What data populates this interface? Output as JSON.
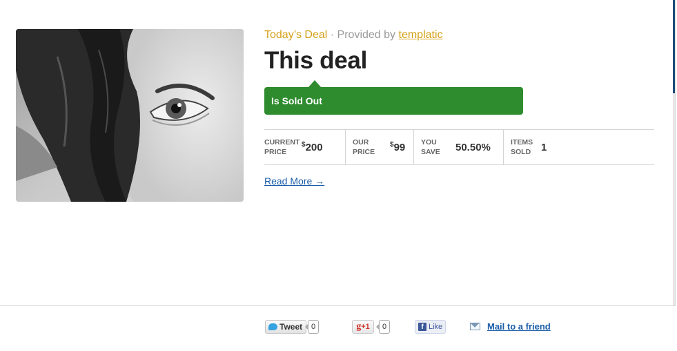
{
  "deal": {
    "todays_deal": "Today’s Deal",
    "separator": "·",
    "provided_by": "Provided by",
    "provider": "templatic",
    "title": "This deal",
    "status": "Is Sold Out",
    "read_more": "Read More →"
  },
  "stats": [
    {
      "label_line1": "CURRENT",
      "label_line2": "PRICE",
      "currency": "$",
      "value": "200"
    },
    {
      "label_line1": "OUR",
      "label_line2": "PRICE",
      "currency": "$",
      "value": "99"
    },
    {
      "label_line1": "YOU",
      "label_line2": "SAVE",
      "currency": "",
      "value": "50.50%"
    },
    {
      "label_line1": "ITEMS",
      "label_line2": "SOLD",
      "currency": "",
      "value": "1"
    }
  ],
  "social": {
    "tweet_label": "Tweet",
    "tweet_count": "0",
    "gplus_g": "g",
    "gplus_label": "+1",
    "gplus_count": "0",
    "fb_f": "f",
    "fb_label": "Like",
    "mail_label": "Mail to a friend"
  },
  "colors": {
    "accent_gold": "#d4a017",
    "sold_out_green": "#2e8b2e",
    "link_blue": "#1a5da8"
  }
}
